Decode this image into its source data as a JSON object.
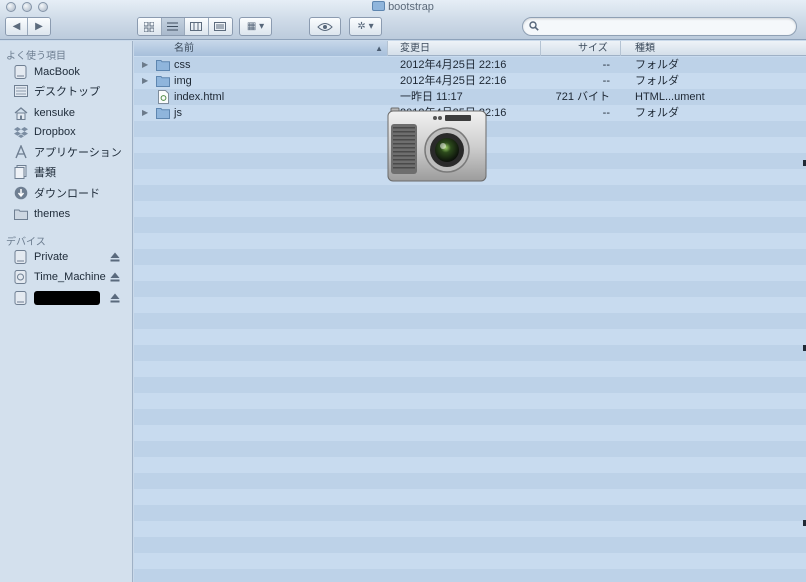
{
  "window": {
    "title": "bootstrap"
  },
  "toolbar": {
    "back": "◀",
    "forward": "▶",
    "views": [
      "icon-view",
      "list-view",
      "column-view",
      "coverflow-view"
    ],
    "arrange": "▦ ▾",
    "quicklook": "👁",
    "action": "✲ ▾",
    "search": {
      "value": "",
      "placeholder": ""
    }
  },
  "sidebar": {
    "favorites_header": "よく使う項目",
    "favorites": [
      {
        "label": "MacBook",
        "icon": "drive-icon"
      },
      {
        "label": "デスクトップ",
        "icon": "desktop-icon"
      },
      {
        "label": "kensuke",
        "icon": "home-icon"
      },
      {
        "label": "Dropbox",
        "icon": "dropbox-icon"
      },
      {
        "label": "アプリケーション",
        "icon": "applications-icon"
      },
      {
        "label": "書類",
        "icon": "documents-icon"
      },
      {
        "label": "ダウンロード",
        "icon": "downloads-icon"
      },
      {
        "label": "themes",
        "icon": "folder-icon"
      }
    ],
    "devices_header": "デバイス",
    "devices": [
      {
        "label": "Private",
        "icon": "drive-icon",
        "eject": true
      },
      {
        "label": "Time_Machine",
        "icon": "timemachine-drive-icon",
        "eject": true
      },
      {
        "label": "",
        "icon": "drive-icon",
        "eject": true,
        "redacted": true
      }
    ]
  },
  "list": {
    "columns": {
      "name": "名前",
      "date": "変更日",
      "size": "サイズ",
      "kind": "種類"
    },
    "sorted_by": "name",
    "rows": [
      {
        "name": "css",
        "date": "2012年4月25日 22:16",
        "size": "--",
        "kind": "フォルダ",
        "type": "folder",
        "expandable": true
      },
      {
        "name": "img",
        "date": "2012年4月25日 22:16",
        "size": "--",
        "kind": "フォルダ",
        "type": "folder",
        "expandable": true
      },
      {
        "name": "index.html",
        "date": "一昨日 11:17",
        "size": "721 バイト",
        "kind": "HTML...ument",
        "type": "html",
        "expandable": false
      },
      {
        "name": "js",
        "date": "2012年4月25日 22:16",
        "size": "--",
        "kind": "フォルダ",
        "type": "folder",
        "expandable": true
      }
    ]
  },
  "overlay": {
    "icon": "screenshot-camera-icon"
  },
  "colors": {
    "list_stripe_a": "#c8dbef",
    "list_stripe_b": "#bdd2e8",
    "sidebar_bg": "#d3e0ed",
    "folder_blue": "#8fb5dc"
  }
}
